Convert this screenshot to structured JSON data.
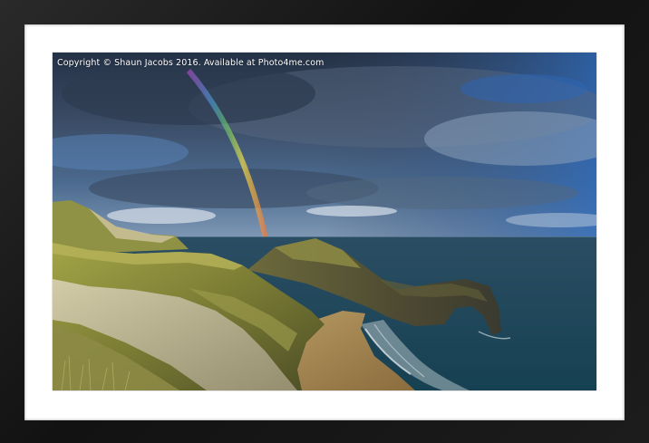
{
  "watermark": {
    "text": "Copyright © Shaun Jacobs  2016. Available at Photo4me.com"
  },
  "colors": {
    "frame": "#1a1a1a",
    "mount": "#ffffff",
    "sky_dark": "#2c3a4e",
    "sky_blue": "#3a6fb0",
    "sea": "#1f4a5a",
    "cliff_grass": "#8a8c3a",
    "chalk": "#c9c2a4",
    "beach": "#a98f5e"
  },
  "image": {
    "subject": "coastal-arch-with-rainbow"
  }
}
